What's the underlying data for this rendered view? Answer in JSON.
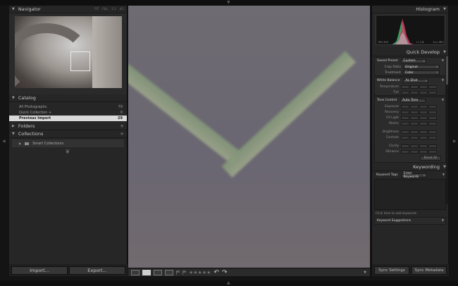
{
  "navigator": {
    "title": "Navigator",
    "zoom": [
      "FIT",
      "FILL",
      "1:1",
      "4:1"
    ]
  },
  "catalog": {
    "title": "Catalog",
    "rows": [
      {
        "label": "All Photographs",
        "count": "79"
      },
      {
        "label": "Quick Collection +",
        "count": "0"
      },
      {
        "label": "Previous Import",
        "count": "29"
      }
    ]
  },
  "folders": {
    "title": "Folders"
  },
  "collections": {
    "title": "Collections",
    "item": "Smart Collections"
  },
  "left_buttons": {
    "import": "Import...",
    "export": "Export..."
  },
  "histogram": {
    "title": "Histogram",
    "iso": "ISO 400",
    "focal": "200 mm",
    "aperture": "f / 1.8",
    "shutter": "1/₁₂₅ SEC"
  },
  "quick_develop": {
    "title": "Quick Develop",
    "saved_preset_label": "Saved Preset",
    "saved_preset_value": "Custom",
    "crop_label": "Crop Ratio",
    "crop_value": "Original",
    "treatment_label": "Treatment",
    "treatment_value": "Color",
    "wb_label": "White Balance",
    "wb_value": "As Shot",
    "temperature": "Temperature",
    "tint": "Tint",
    "tone_label": "Tone Control",
    "tone_value": "Auto Tone",
    "exposure": "Exposure",
    "recovery": "Recovery",
    "fill_light": "Fill Light",
    "blacks": "Blacks",
    "brightness": "Brightness",
    "contrast": "Contrast",
    "clarity": "Clarity",
    "vibrance": "Vibrance",
    "reset": "Reset All"
  },
  "keywording": {
    "title": "Keywording",
    "tags_label": "Keyword Tags",
    "tags_value": "Enter Keywords",
    "hint": "Click here to add keywords",
    "suggestions": "Keyword Suggestions"
  },
  "right_buttons": {
    "sync_settings": "Sync Settings",
    "sync_metadata": "Sync Metadata"
  },
  "colors": {
    "accent_selected": "#d9d9d9",
    "panel": "#262626",
    "background": "#141414"
  }
}
